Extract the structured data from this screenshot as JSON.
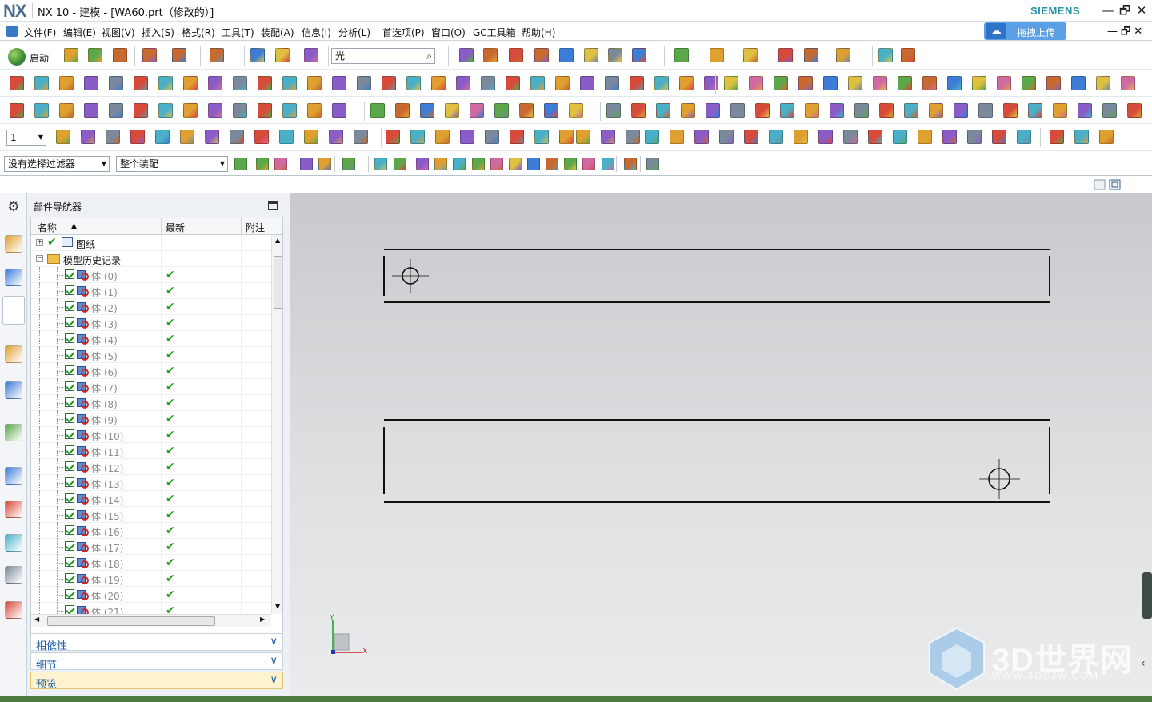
{
  "titlebar": {
    "logo": "NX",
    "title": "NX 10 - 建模 - [WA60.prt（修改的）]",
    "brand": "SIEMENS",
    "min": "—",
    "restore": "🗗",
    "close": "✕"
  },
  "menu": {
    "items": [
      "文件(F)",
      "编辑(E)",
      "视图(V)",
      "插入(S)",
      "格式(R)",
      "工具(T)",
      "装配(A)",
      "信息(I)",
      "分析(L)",
      "首选项(P)",
      "窗口(O)",
      "GC工具箱",
      "帮助(H)"
    ],
    "upload_label": "拖拽上传",
    "window_controls": "—🗗✕"
  },
  "toolbar": {
    "start_label": "启动",
    "search_value": "光",
    "layer_value": "1",
    "selection_filter": "没有选择过滤器",
    "assembly_scope": "整个装配"
  },
  "navigator": {
    "title": "部件导航器",
    "columns": [
      "名称",
      "最新",
      "附注"
    ],
    "drawing_node": "图纸",
    "history_node": "模型历史记录",
    "bodies": [
      "体 (0)",
      "体 (1)",
      "体 (2)",
      "体 (3)",
      "体 (4)",
      "体 (5)",
      "体 (6)",
      "体 (7)",
      "体 (8)",
      "体 (9)",
      "体 (10)",
      "体 (11)",
      "体 (12)",
      "体 (13)",
      "体 (14)",
      "体 (15)",
      "体 (16)",
      "体 (17)",
      "体 (18)",
      "体 (19)",
      "体 (20)",
      "体 (21)"
    ],
    "panels": [
      "相依性",
      "细节",
      "预览"
    ]
  },
  "graphics": {
    "axis_x": "X",
    "axis_y": "Y",
    "watermark": "3D世界网",
    "watermark_url": "WWW.3DSJW.COM"
  },
  "colors": {
    "accent": "#1b5aa6",
    "check_green": "#1fa31f",
    "brand": "#2a93a6"
  }
}
